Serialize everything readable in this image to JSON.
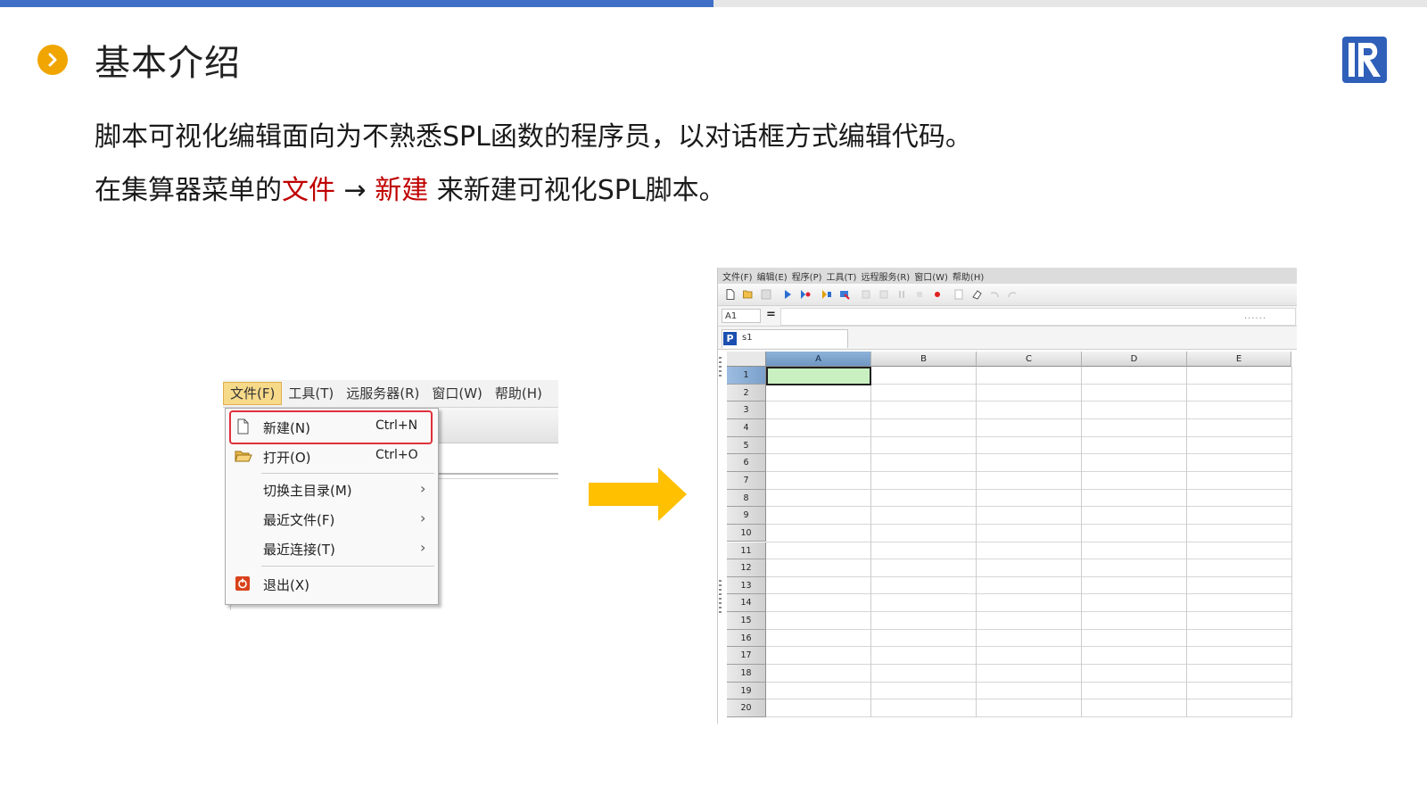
{
  "header": {
    "title": "基本介绍",
    "progress_fraction": 0.5
  },
  "intro": {
    "line1": "脚本可视化编辑面向为不熟悉SPL函数的程序员，以对话框方式编辑代码。",
    "line2_prefix": "在集算器菜单的",
    "line2_file": "文件",
    "line2_arrow": " → ",
    "line2_new": "新建",
    "line2_suffix": " 来新建可视化SPL脚本。"
  },
  "menu_screenshot": {
    "menubar": [
      "文件(F)",
      "工具(T)",
      "远服务器(R)",
      "窗口(W)",
      "帮助(H)"
    ],
    "items": {
      "new": {
        "label": "新建(N)",
        "shortcut": "Ctrl+N"
      },
      "open": {
        "label": "打开(O)",
        "shortcut": "Ctrl+O"
      },
      "switch_home": {
        "label": "切换主目录(M)"
      },
      "recent_files": {
        "label": "最近文件(F)"
      },
      "recent_conn": {
        "label": "最近连接(T)"
      },
      "exit": {
        "label": "退出(X)"
      }
    },
    "highlight_color": "#e0303c"
  },
  "spreadsheet_screenshot": {
    "menubar": [
      "文件(F)",
      "编辑(E)",
      "程序(P)",
      "工具(T)",
      "远程服务(R)",
      "窗口(W)",
      "帮助(H)"
    ],
    "cell_ref": "A1",
    "equals": "=",
    "tab_icon": "P",
    "tab_name": "s1",
    "columns": [
      "A",
      "B",
      "C",
      "D",
      "E"
    ],
    "rows": [
      "1",
      "2",
      "3",
      "4",
      "5",
      "6",
      "7",
      "8",
      "9",
      "10",
      "11",
      "12",
      "13",
      "14",
      "15",
      "16",
      "17",
      "18",
      "19",
      "20"
    ],
    "selected_cell": "A1"
  },
  "colors": {
    "accent_blue": "#3f6fc7",
    "bullet_orange": "#f0a500",
    "highlight_red": "#c00000",
    "arrow_yellow": "#ffc000",
    "selected_cell_fill": "#c9f0c0"
  }
}
